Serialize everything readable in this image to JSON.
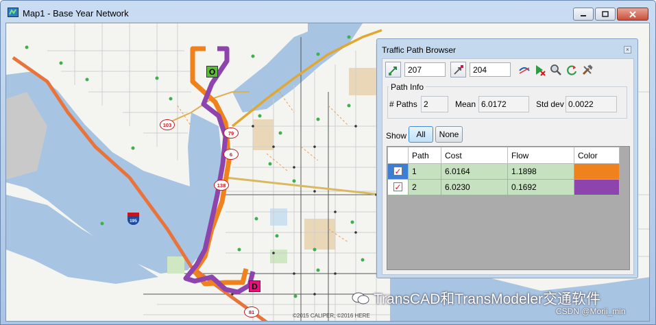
{
  "window": {
    "title": "Map1 - Base Year Network"
  },
  "colors": {
    "path1": "#f0821e",
    "path2": "#8e44ad",
    "water": "#a7c4e3",
    "origin": "#5dbb3a",
    "destination": "#e6127a"
  },
  "map": {
    "origin_label": "O",
    "destination_label": "D",
    "route_shields": [
      "103",
      "79",
      "6",
      "138",
      "81"
    ],
    "interstate_shield": "195",
    "copyright": "©2015 CALIPER; ©2016 HERE"
  },
  "panel": {
    "title": "Traffic Path Browser",
    "close_glyph": "×",
    "from_node": "207",
    "to_node": "204",
    "icons": [
      "origin-node-icon",
      "destination-node-icon",
      "show-path-icon",
      "clear-path-icon",
      "zoom-icon",
      "refresh-icon",
      "settings-icon"
    ],
    "path_info": {
      "label": "Path Info",
      "paths_label": "# Paths",
      "paths_value": "2",
      "mean_label": "Mean",
      "mean_value": "6.0172",
      "std_label": "Std dev",
      "std_value": "0.0022"
    },
    "show": {
      "label": "Show",
      "all": "All",
      "none": "None"
    },
    "table": {
      "headers": [
        "Path",
        "Cost",
        "Flow",
        "Color"
      ],
      "rows": [
        {
          "path": "1",
          "cost": "6.0164",
          "flow": "1.1898",
          "color": "#f0821e",
          "checked": true
        },
        {
          "path": "2",
          "cost": "6.0230",
          "flow": "0.1692",
          "color": "#8e44ad",
          "checked": true
        }
      ]
    }
  },
  "watermark": {
    "text": "TransCAD和TransModeler交通软件",
    "author": "CSDN @Morii_min"
  }
}
